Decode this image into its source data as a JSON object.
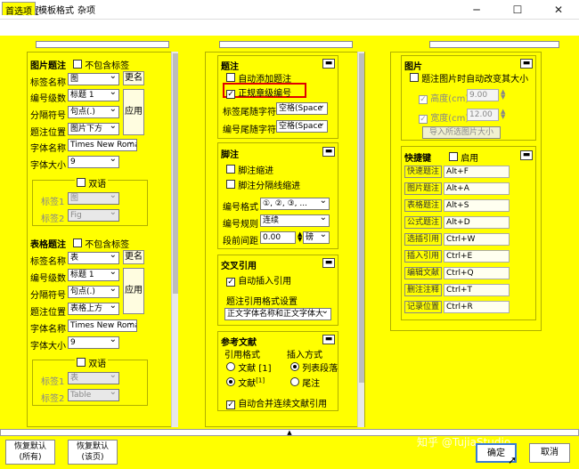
{
  "window": {
    "title": "设置",
    "controls": {
      "minimize": "─",
      "maximize": "☐",
      "close": "✕"
    }
  },
  "tabs": [
    "首选项",
    "模板格式",
    "杂项"
  ],
  "figure_caption": {
    "title": "图片题注",
    "exclude": "不包含标签",
    "rows": [
      {
        "label": "标签名称",
        "value": "图"
      },
      {
        "label": "编号级数",
        "value": "标题 1"
      },
      {
        "label": "分隔符号",
        "value": "句点(.)"
      },
      {
        "label": "题注位置",
        "value": "图片下方"
      },
      {
        "label": "字体名称",
        "value": "Times New Roma"
      },
      {
        "label": "字体大小",
        "value": "9"
      }
    ],
    "rename": "更名",
    "apply": "应用",
    "bilingual": "双语",
    "tag1": "标签1",
    "tag1_val": "图",
    "tag2": "标签2",
    "tag2_val": "Fig"
  },
  "table_caption": {
    "title": "表格题注",
    "exclude": "不包含标签",
    "rows": [
      {
        "label": "标签名称",
        "value": "表"
      },
      {
        "label": "编号级数",
        "value": "标题 1"
      },
      {
        "label": "分隔符号",
        "value": "句点(.)"
      },
      {
        "label": "题注位置",
        "value": "表格上方"
      },
      {
        "label": "字体名称",
        "value": "Times New Roma"
      },
      {
        "label": "字体大小",
        "value": "9"
      }
    ],
    "rename": "更名",
    "apply": "应用",
    "bilingual": "双语",
    "tag1": "标签1",
    "tag1_val": "表",
    "tag2": "标签2",
    "tag2_val": "Table"
  },
  "caption": {
    "title": "题注",
    "auto_add": "自动添加题注",
    "normalize": "正规章级编号",
    "tag_suffix": "标签尾随字符",
    "tag_suffix_val": "空格(Space",
    "num_suffix": "编号尾随字符",
    "num_suffix_val": "空格(Space"
  },
  "footnote": {
    "title": "脚注",
    "indent": "脚注缩进",
    "sep_indent": "脚注分隔线缩进",
    "num_format": "编号格式",
    "num_format_val": "①, ②, ③, ...",
    "num_rule": "编号规则",
    "num_rule_val": "连续",
    "spacing": "段前间距",
    "spacing_val": "0.00",
    "spacing_unit": "磅"
  },
  "cross_ref": {
    "title": "交叉引用",
    "auto_insert": "自动插入引用",
    "settings": "题注引用格式设置",
    "format_val": "正文字体名称和正文字体大"
  },
  "references": {
    "title": "参考文献",
    "cite_format": "引用格式",
    "insert_mode": "插入方式",
    "opt1": "文献 [1]",
    "opt2": "文献",
    "opt2_sup": "[1]",
    "mode1": "列表段落",
    "mode2": "尾注",
    "merge": "自动合并连续文献引用"
  },
  "image": {
    "title": "图片",
    "auto_resize": "题注图片时自动改变其大小",
    "height": "高度(cm)",
    "height_val": "9.00",
    "width": "宽度(cm)",
    "width_val": "12.00",
    "import": "导入所选图片大小"
  },
  "shortcuts": {
    "title": "快捷键",
    "enable": "启用",
    "items": [
      {
        "name": "快速题注",
        "key": "Alt+F"
      },
      {
        "name": "图片题注",
        "key": "Alt+A"
      },
      {
        "name": "表格题注",
        "key": "Alt+S"
      },
      {
        "name": "公式题注",
        "key": "Alt+D"
      },
      {
        "name": "选插引用",
        "key": "Ctrl+W"
      },
      {
        "name": "插入引用",
        "key": "Ctrl+E"
      },
      {
        "name": "编辑文献",
        "key": "Ctrl+Q"
      },
      {
        "name": "删注注释",
        "key": "Ctrl+T"
      },
      {
        "name": "记录位置",
        "key": "Ctrl+R"
      }
    ]
  },
  "footer": {
    "restore_all_1": "恢复默认",
    "restore_all_2": "(所有)",
    "restore_cur_1": "恢复默认",
    "restore_cur_2": "(该页)",
    "ok": "确定",
    "cancel": "取消",
    "watermark": "知乎 @TujiaStudio"
  },
  "colors": {
    "background": "#ffff00",
    "highlight_box": "#e00000"
  }
}
